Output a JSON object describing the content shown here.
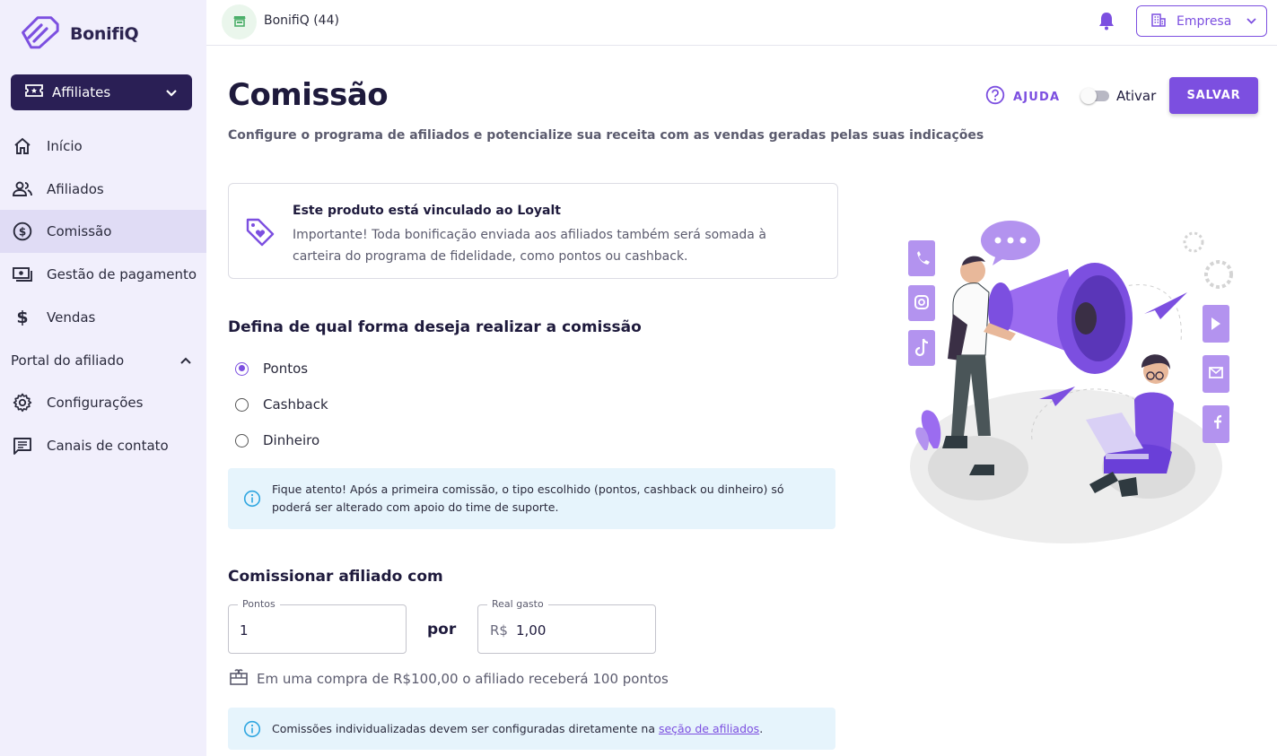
{
  "brand": {
    "name": "BonifiQ",
    "accent": "#7c4fe0",
    "dark": "#2a1f55"
  },
  "sidebar": {
    "app_select": {
      "label": "Affiliates",
      "icon": "ticket-icon"
    },
    "items": [
      {
        "label": "Início",
        "icon": "home-icon"
      },
      {
        "label": "Afiliados",
        "icon": "users-icon"
      },
      {
        "label": "Comissão",
        "icon": "dollar-circle-icon",
        "active": true
      },
      {
        "label": "Gestão de pagamento",
        "icon": "payment-icon"
      },
      {
        "label": "Vendas",
        "icon": "dollar-icon"
      }
    ],
    "section": {
      "label": "Portal do afiliado",
      "expanded": true
    },
    "section_items": [
      {
        "label": "Configurações",
        "icon": "gear-icon"
      },
      {
        "label": "Canais de contato",
        "icon": "chat-icon"
      }
    ]
  },
  "topbar": {
    "store_name": "BonifiQ (44)",
    "company_select": "Empresa"
  },
  "header": {
    "title": "Comissão",
    "subtitle": "Configure o programa de afiliados e potencialize sua receita com as vendas geradas pelas suas indicações",
    "help_label": "AJUDA",
    "toggle_label": "Ativar",
    "toggle_on": false,
    "save_label": "SALVAR"
  },
  "loyalty_card": {
    "title": "Este produto está vinculado ao Loyalt",
    "body": "Importante! Toda bonificação enviada aos afiliados também será somada à carteira do programa de fidelidade, como pontos ou cashback."
  },
  "commission_type": {
    "title": "Defina de qual forma deseja realizar a comissão",
    "options": [
      {
        "label": "Pontos",
        "checked": true
      },
      {
        "label": "Cashback",
        "checked": false
      },
      {
        "label": "Dinheiro",
        "checked": false
      }
    ],
    "alert": "Fique atento! Após a primeira comissão, o tipo escolhido (pontos, cashback ou dinheiro) só poderá ser alterado com apoio do time de suporte."
  },
  "commission_rate": {
    "title": "Comissionar afiliado com",
    "points_label": "Pontos",
    "points_value": "1",
    "per_label": "por",
    "spent_label": "Real gasto",
    "spent_prefix": "R$",
    "spent_value": "1,00",
    "example": "Em uma compra de R$100,00 o afiliado receberá 100 pontos",
    "footer_alert_text": "Comissões individualizadas devem ser configuradas diretamente na ",
    "footer_alert_link": "seção de afiliados",
    "footer_alert_end": "."
  }
}
